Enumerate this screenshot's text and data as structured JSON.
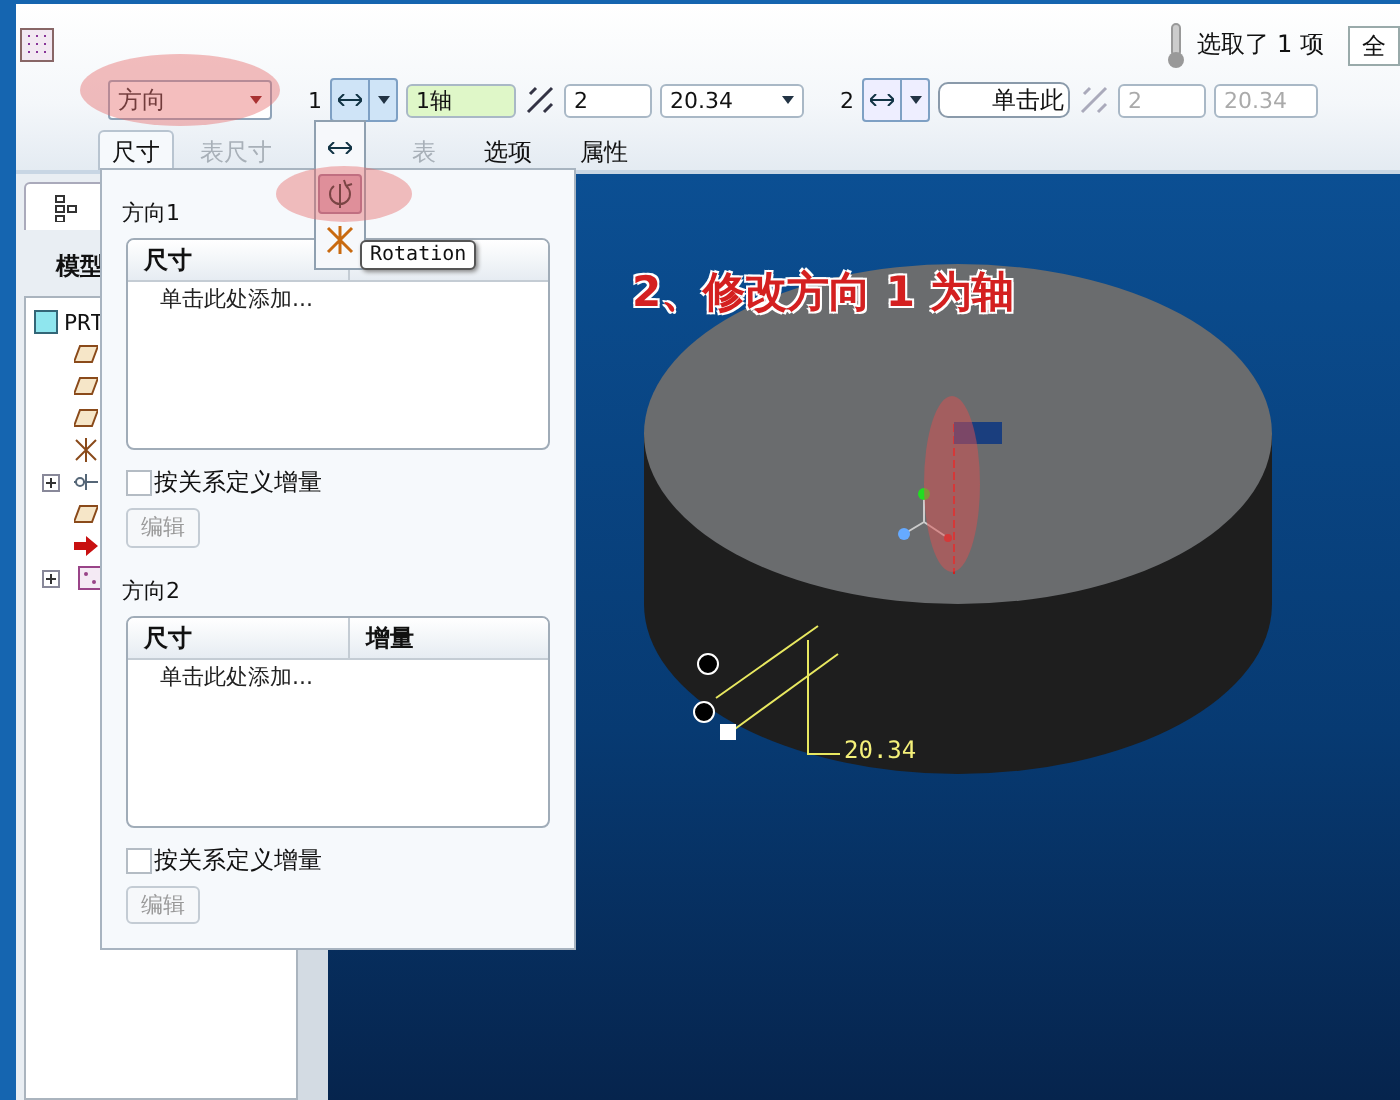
{
  "selection_status": {
    "text": "选取了 1 项",
    "filter": "全"
  },
  "dashboard": {
    "type_dropdown": {
      "value": "方向",
      "highlighted": true
    },
    "direction1": {
      "index": "1",
      "reference": "1轴",
      "count": "2",
      "increment": "20.34",
      "disabled": false
    },
    "direction2": {
      "index": "2",
      "reference": "单击此",
      "count": "2",
      "increment": "20.34",
      "disabled": true
    }
  },
  "tabs": [
    {
      "label": "尺寸",
      "selected": true,
      "disabled": false
    },
    {
      "label": "表尺寸",
      "selected": false,
      "disabled": true
    },
    {
      "label": "表",
      "selected": false,
      "disabled": true
    },
    {
      "label": "选项",
      "selected": false,
      "disabled": false
    },
    {
      "label": "属性",
      "selected": false,
      "disabled": false
    }
  ],
  "arrow_menu": {
    "items": [
      {
        "kind": "translate",
        "selected": false,
        "highlighted": false
      },
      {
        "kind": "rotate",
        "selected": true,
        "highlighted": true
      },
      {
        "kind": "projection",
        "selected": false,
        "highlighted": false
      }
    ],
    "tooltip": "Rotation"
  },
  "model_tree": {
    "heading": "模型",
    "root": {
      "label": "PRT",
      "children": [
        {
          "kind": "plane"
        },
        {
          "kind": "plane"
        },
        {
          "kind": "plane"
        },
        {
          "kind": "csys"
        },
        {
          "kind": "group"
        },
        {
          "kind": "plane"
        },
        {
          "kind": "insert"
        },
        {
          "kind": "pattern"
        }
      ]
    }
  },
  "panel": {
    "sections": [
      {
        "title": "方向1",
        "columns": [
          "尺寸"
        ],
        "add_row": "单击此处添加...",
        "relation_checkbox": {
          "label": "按关系定义增量",
          "checked": false
        },
        "edit_button": {
          "label": "编辑",
          "disabled": true
        }
      },
      {
        "title": "方向2",
        "columns": [
          "尺寸",
          "增量"
        ],
        "add_row": "单击此处添加...",
        "relation_checkbox": {
          "label": "按关系定义增量",
          "checked": false
        },
        "edit_button": {
          "label": "编辑",
          "disabled": true
        }
      }
    ]
  },
  "viewport": {
    "annotation": "2、修改方向 1 为轴",
    "dimension": "20.34",
    "axis_highlighted": true
  }
}
